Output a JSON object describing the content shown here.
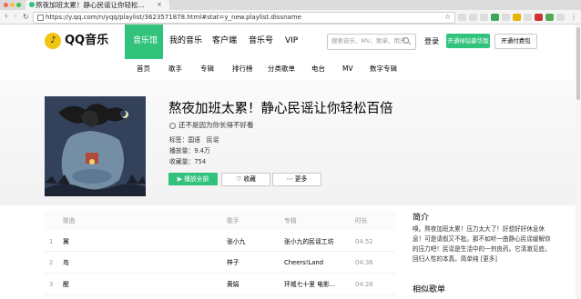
{
  "browser": {
    "tab_title": "熬夜加班太累！静心民谣让你轻松...",
    "tab_close": "×",
    "url": "https://y.qq.com/n/yqq/playlist/3623571878.html#stat=y_new.playlist.dissname",
    "back": "‹",
    "forward": "›",
    "reload": "↻",
    "star": "☆",
    "menu": "⋮"
  },
  "header": {
    "logo_text": "QQ音乐",
    "nav": [
      "音乐馆",
      "我的音乐",
      "客户端",
      "音乐号",
      "VIP"
    ],
    "search_placeholder": "搜索音乐、MV、歌单、用户",
    "login": "登录",
    "btn_green": "开通绿钻豪华版",
    "btn_white": "开通付费包"
  },
  "subnav": [
    "首页",
    "歌手",
    "专辑",
    "排行榜",
    "分类歌单",
    "电台",
    "MV",
    "数字专辑"
  ],
  "playlist": {
    "title": "熬夜加班太累！静心民谣让你轻松百倍",
    "creator": "还不是因为你长得不好看",
    "tags_label": "标签：",
    "tags": "国语　民谣",
    "plays_label": "播放量：",
    "plays": "9.4万",
    "favs_label": "收藏量：",
    "favs": "754",
    "btn_play": "播放全部",
    "btn_fav": "收藏",
    "btn_more": "更多"
  },
  "song_list": {
    "headers": {
      "song": "歌曲",
      "singer": "歌手",
      "album": "专辑",
      "time": "时长"
    },
    "rows": [
      {
        "num": "1",
        "song": "冀",
        "singer": "张小九",
        "album": "张小九的民谣工坊",
        "time": "04:52"
      },
      {
        "num": "2",
        "song": "岛",
        "singer": "梓子",
        "album": "Cheers!Land",
        "time": "04:36"
      },
      {
        "num": "3",
        "song": "醒",
        "singer": "黄娟",
        "album": "环城七十里 电影...",
        "time": "04:28"
      }
    ]
  },
  "sidebar": {
    "intro_title": "简介",
    "intro_text": "嗅。熬夜加班太累！压力太大了！好想好好休息休息！可是请假又不批。那不如听一曲静心民谣缓解你的压力吧！民谣是生活中的一剂良药。它清澈见底，回归人性的本真。简单纯",
    "more": "[更多]",
    "similar_title": "相似歌单"
  },
  "colors": {
    "brand_green": "#31c27c",
    "logo_yellow": "#f1c40f"
  }
}
